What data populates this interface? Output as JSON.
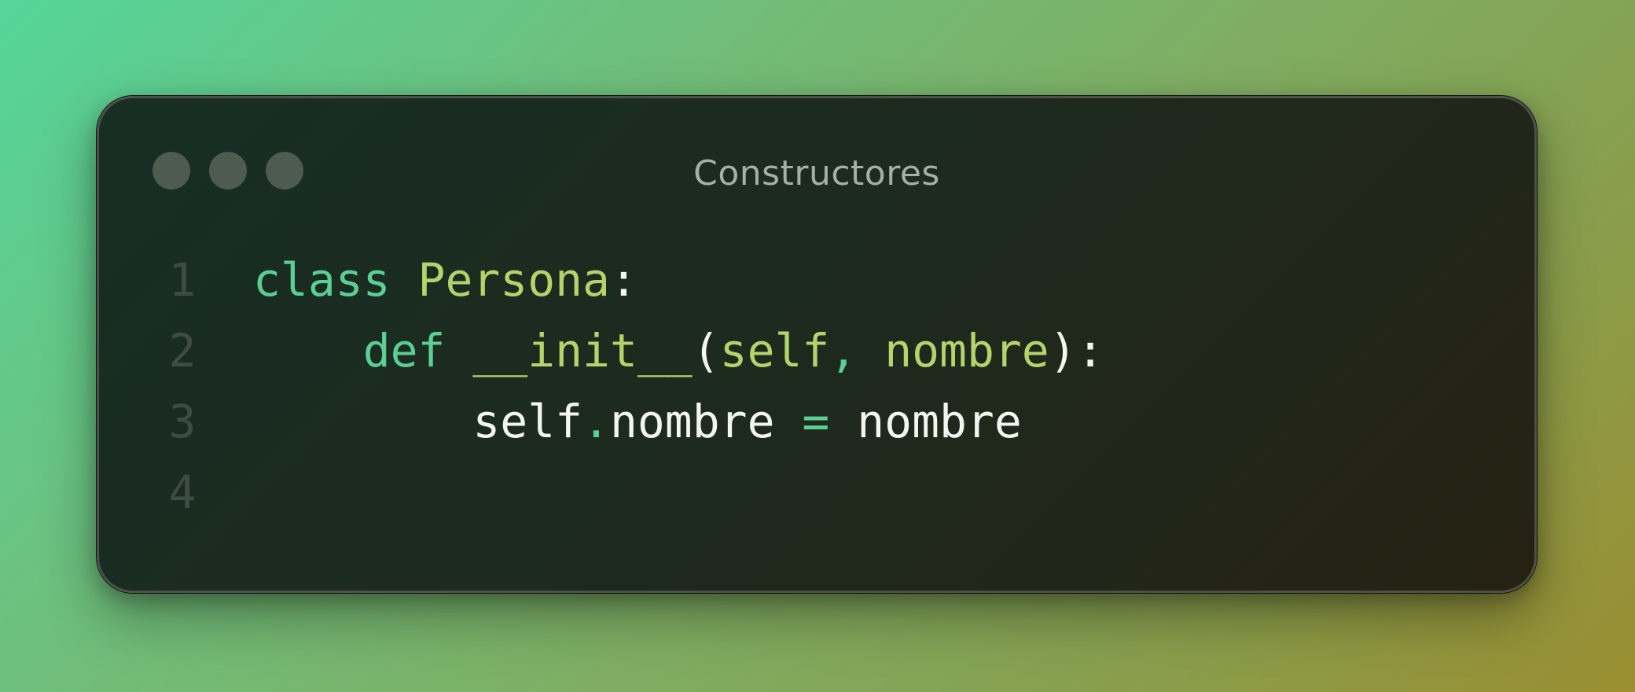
{
  "window": {
    "title": "Constructores",
    "controls": [
      "close-dot",
      "minimize-dot",
      "maximize-dot"
    ]
  },
  "code": {
    "language": "python",
    "lines": [
      {
        "number": "1",
        "tokens": [
          {
            "text": "class",
            "kind": "kw"
          },
          {
            "text": " ",
            "kind": "plain"
          },
          {
            "text": "Persona",
            "kind": "cls"
          },
          {
            "text": ":",
            "kind": "plain"
          }
        ]
      },
      {
        "number": "2",
        "tokens": [
          {
            "text": "    ",
            "kind": "plain"
          },
          {
            "text": "def",
            "kind": "kw"
          },
          {
            "text": " ",
            "kind": "plain"
          },
          {
            "text": "__init__",
            "kind": "cls"
          },
          {
            "text": "(",
            "kind": "plain"
          },
          {
            "text": "self",
            "kind": "param"
          },
          {
            "text": ",",
            "kind": "op"
          },
          {
            "text": " ",
            "kind": "plain"
          },
          {
            "text": "nombre",
            "kind": "param"
          },
          {
            "text": "):",
            "kind": "plain"
          }
        ]
      },
      {
        "number": "3",
        "tokens": [
          {
            "text": "        ",
            "kind": "plain"
          },
          {
            "text": "self",
            "kind": "plain"
          },
          {
            "text": ".",
            "kind": "op"
          },
          {
            "text": "nombre",
            "kind": "plain"
          },
          {
            "text": " ",
            "kind": "plain"
          },
          {
            "text": "=",
            "kind": "op"
          },
          {
            "text": " ",
            "kind": "plain"
          },
          {
            "text": "nombre",
            "kind": "plain"
          }
        ]
      },
      {
        "number": "4",
        "tokens": []
      }
    ]
  },
  "colors": {
    "keyword": "#5bcf93",
    "class_name": "#b2d46b",
    "plain": "#f3f5f1",
    "line_number": "#3f4c43",
    "title": "#a7aea6"
  }
}
